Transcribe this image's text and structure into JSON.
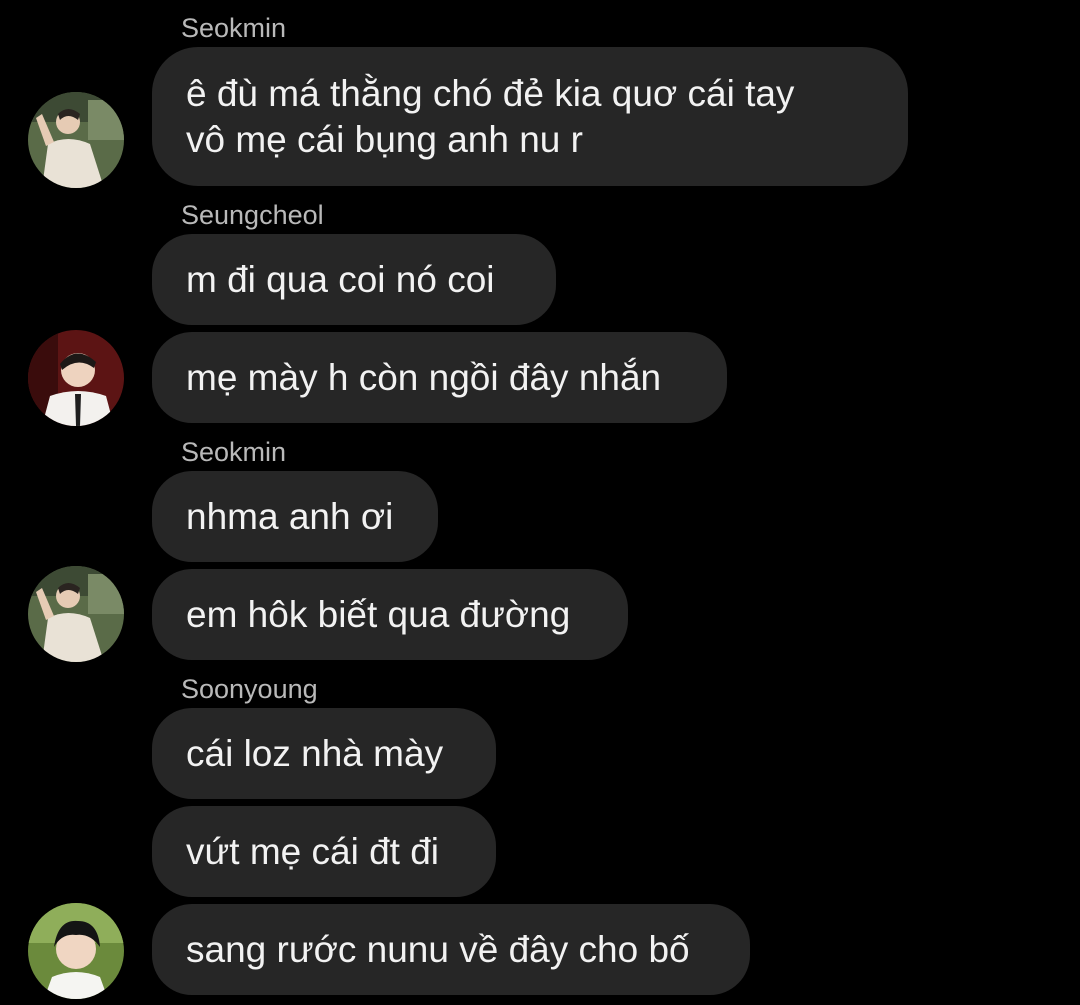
{
  "thread": {
    "groups": [
      {
        "sender": "Seokmin",
        "messages": [
          "ê đù má thằng chó đẻ kia quơ cái tay\nvô mẹ cái bụng anh nu r"
        ]
      },
      {
        "sender": "Seungcheol",
        "messages": [
          "m đi qua coi nó coi",
          "mẹ mày h còn ngồi đây nhắn"
        ]
      },
      {
        "sender": "Seokmin",
        "messages": [
          "nhma anh ơi",
          "em hôk biết qua đường"
        ]
      },
      {
        "sender": "Soonyoung",
        "messages": [
          "cái loz nhà mày",
          "vứt mẹ cái đt đi",
          "sang rước nunu về đây cho bố"
        ]
      }
    ]
  },
  "avatars": {
    "seokmin": "profile-photo-seokmin",
    "seungcheol": "profile-photo-seungcheol",
    "soonyoung": "profile-photo-soonyoung"
  },
  "colors": {
    "background": "#000000",
    "bubble": "#262626",
    "message_text": "#f2f2f2",
    "sender_name": "#b9b9b9"
  }
}
